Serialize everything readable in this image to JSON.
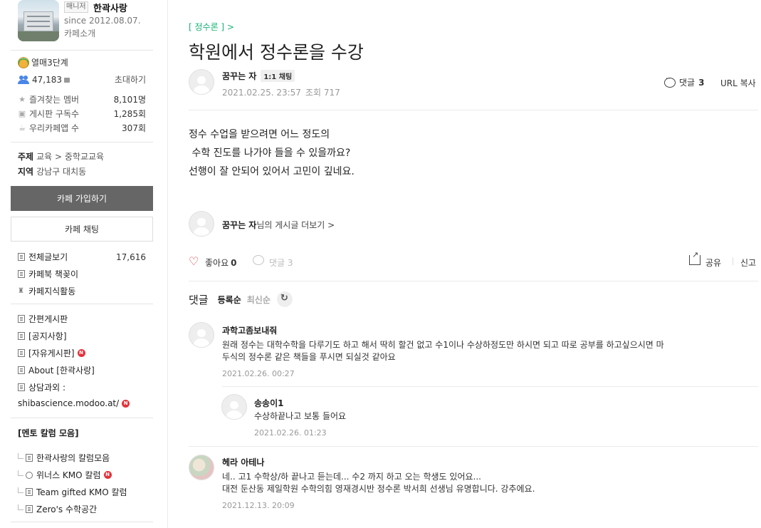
{
  "sidebar": {
    "manager_tag": "매니저",
    "cafe_name": "한곽사랑",
    "since": "since 2012.08.07.",
    "intro_link": "카페소개",
    "grade": "열매3단계",
    "member_count": "47,183",
    "invite": "초대하기",
    "stats": [
      {
        "label": "즐겨찾는 멤버",
        "value": "8,101명"
      },
      {
        "label": "게시판 구독수",
        "value": "1,285회"
      },
      {
        "label": "우리카페앱 수",
        "value": "307회"
      }
    ],
    "topic_label": "주제",
    "topic_value": "교육 > 중학교교육",
    "region_label": "지역",
    "region_value": "강남구 대치동",
    "join_button": "카페 가입하기",
    "chat_button": "카페 채팅",
    "all_posts": {
      "label": "전체글보기",
      "count": "17,616"
    },
    "bookmark": "카페북 책꽂이",
    "knowledge": "카페지식활동",
    "boards": [
      "간편게시판",
      "[공지사항]",
      "[자유게시판]",
      "About [한곽사랑]",
      "상담과외 :",
      "shibascience.modoo.at/"
    ],
    "new_badge": "N",
    "mentor_section": "[멘토 칼럼 모음]",
    "mentor_boards": [
      "한곽사랑의 칼럼모음",
      "위너스 KMO 칼럼",
      "Team gifted KMO 칼럼",
      "Zero's 수학공간"
    ]
  },
  "post": {
    "board": "[ 정수론 ] >",
    "title": "학원에서 정수론을 수강",
    "author": "꿈꾸는 자",
    "chat_tag": "1:1 채팅",
    "datetime": "2021.02.25. 23:57",
    "views": "조회 717",
    "comment_count_label": "댓글",
    "comment_count": "3",
    "url_copy": "URL 복사",
    "body_lines": [
      "정수 수업을 받으려면 어느 정도의",
      " 수학 진도를 나가야 들을 수 있을까요?",
      "선행이 잘 안되어 있어서 고민이 깊네요."
    ],
    "more_author_name": "꿈꾸는 자",
    "more_author_suffix": "님의 게시글 더보기 >",
    "like_label": "좋아요",
    "like_count": "0",
    "comment_label_grey": "댓글 3",
    "share": "공유",
    "report": "신고"
  },
  "comments_section": {
    "title": "댓글",
    "sort_register": "등록순",
    "sort_latest": "최신순"
  },
  "comments": [
    {
      "name": "과학고좀보내줘",
      "lines": [
        "원래 정수는 대학수학을 다루기도 하고 해서 딱히 할건 없고 수1이나 수상하정도만 하시면 되고 따로 공부를 하고싶으시면 마",
        "두식의 정수론 같은 책들을 푸시면 되실것 같아요"
      ],
      "date": "2021.02.26. 00:27"
    },
    {
      "name": "송송이1",
      "lines": [
        "수상하끝나고 보통 들어요"
      ],
      "date": "2021.02.26. 01:23"
    },
    {
      "name": "헤라 아테나",
      "lines": [
        "네.. 고1 수학상/하 끝나고 듣는데... 수2 까지 하고 오는 학생도 있어요...",
        "대전 둔산동 제일학원 수학의힘 영재경시반 정수론 박서희 선생님 유명합니다. 강추에요."
      ],
      "date": "2021.12.13. 20:09"
    }
  ],
  "colors": {
    "accent_green": "#15b371",
    "new_badge_red": "#e5323a",
    "join_button_bg": "#666666"
  }
}
